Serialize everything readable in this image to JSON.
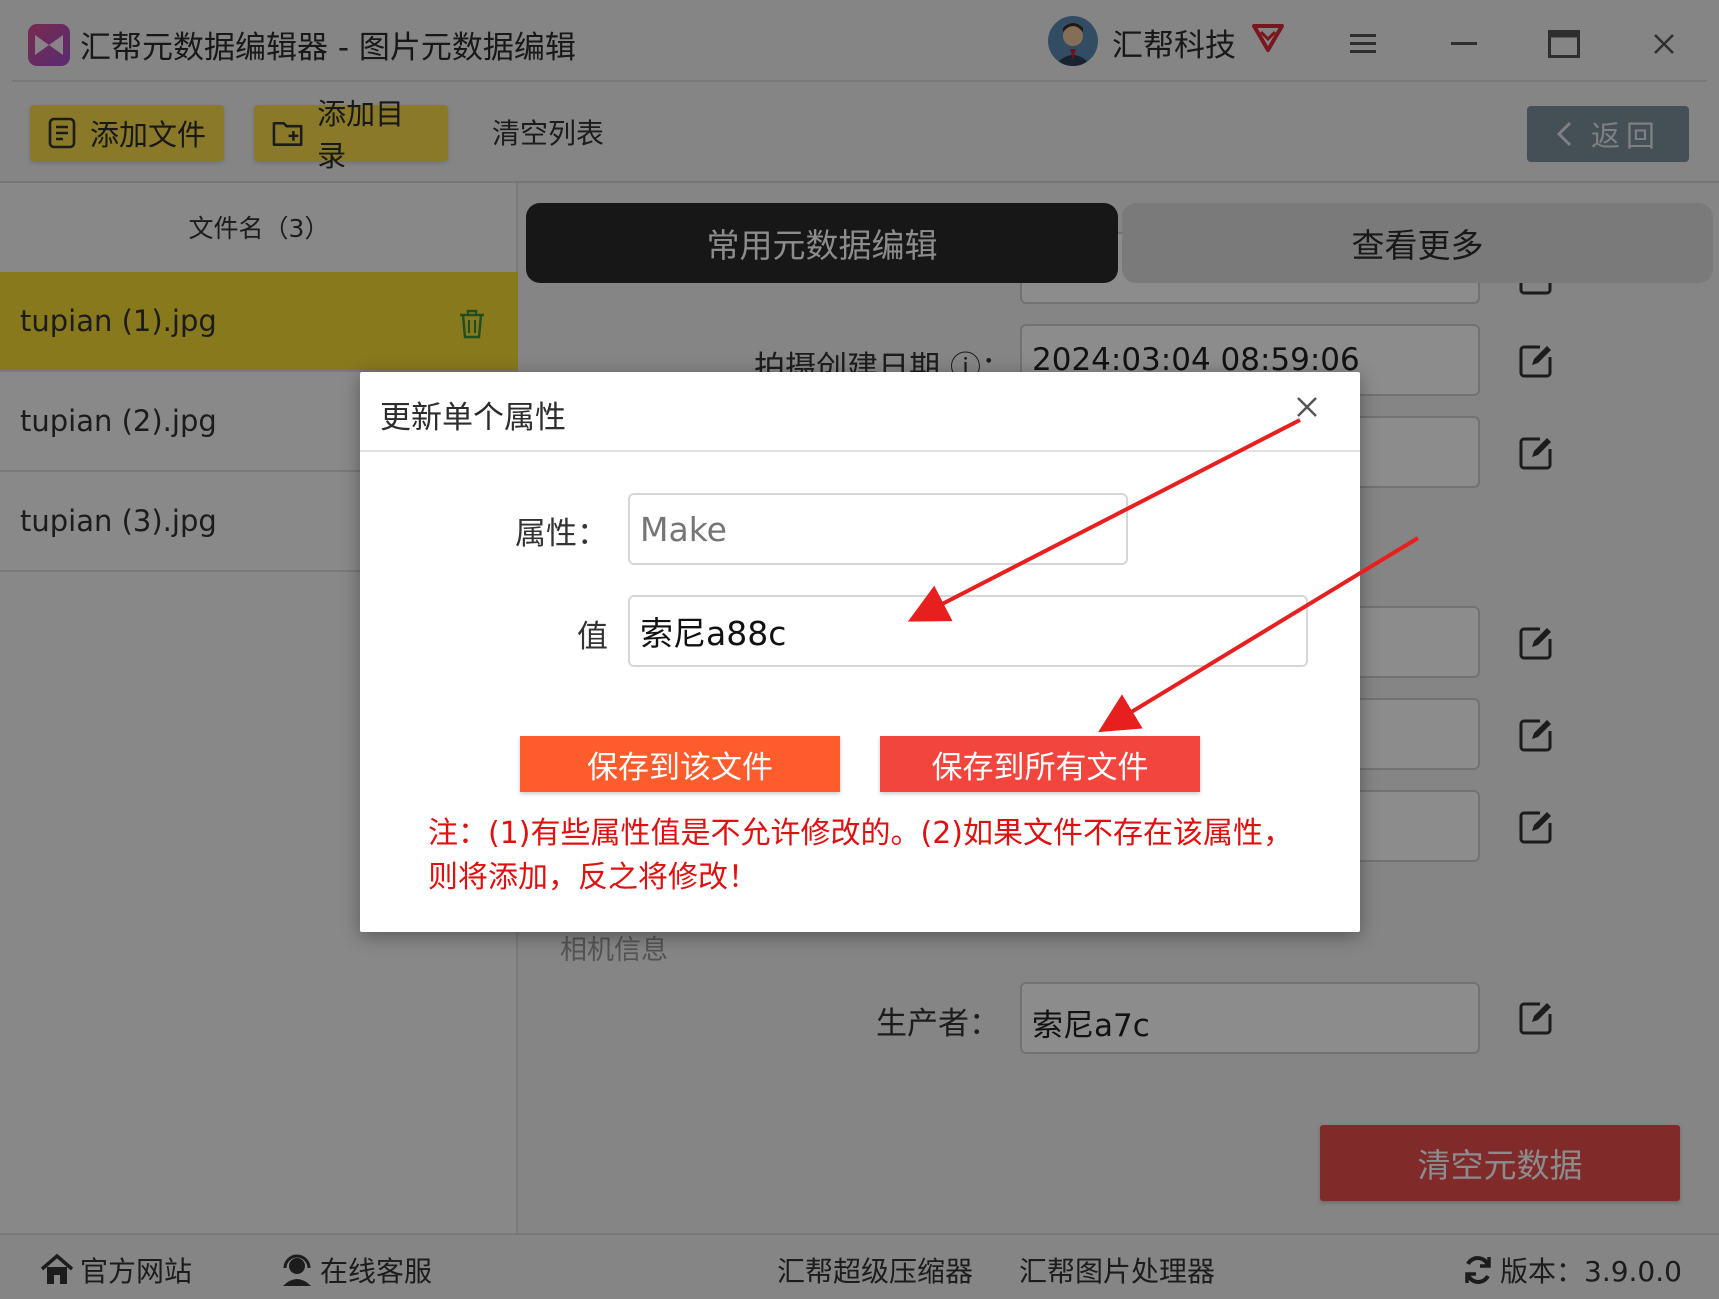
{
  "app": {
    "title": "汇帮元数据编辑器 - 图片元数据编辑",
    "user_name": "汇帮科技"
  },
  "toolbar": {
    "add_file": "添加文件",
    "add_dir": "添加目录",
    "clear_list": "清空列表",
    "back": "返回"
  },
  "file_list": {
    "header": "文件名（3）",
    "items": [
      {
        "name": "tupian (1).jpg"
      },
      {
        "name": "tupian (2).jpg"
      },
      {
        "name": "tupian (3).jpg"
      }
    ]
  },
  "tabs": {
    "common": "常用元数据编辑",
    "more": "查看更多"
  },
  "fields": {
    "capture_date_label": "拍摄创建日期 ⓘ：",
    "capture_date_value": "2024:03:04 08:59:06",
    "section_camera": "相机信息",
    "maker_label": "生产者：",
    "maker_value": "索尼a7c"
  },
  "clear_meta": "清空元数据",
  "dialog": {
    "title": "更新单个属性",
    "prop_label": "属性：",
    "prop_placeholder": "Make",
    "value_label": "值",
    "value": "索尼a88c",
    "save_this": "保存到该文件",
    "save_all": "保存到所有文件",
    "note": "注：(1)有些属性值是不允许修改的。(2)如果文件不存在该属性，则将添加，反之将修改！"
  },
  "footer": {
    "website": "官方网站",
    "support": "在线客服",
    "compressor": "汇帮超级压缩器",
    "image_processor": "汇帮图片处理器",
    "version": "版本：3.9.0.0"
  },
  "colors": {
    "accent_yellow": "#f8dc35",
    "tab_dark": "#2a2a2a",
    "save_orange": "#fe5c2c",
    "save_red": "#f1453d",
    "note_red": "#e01010"
  }
}
